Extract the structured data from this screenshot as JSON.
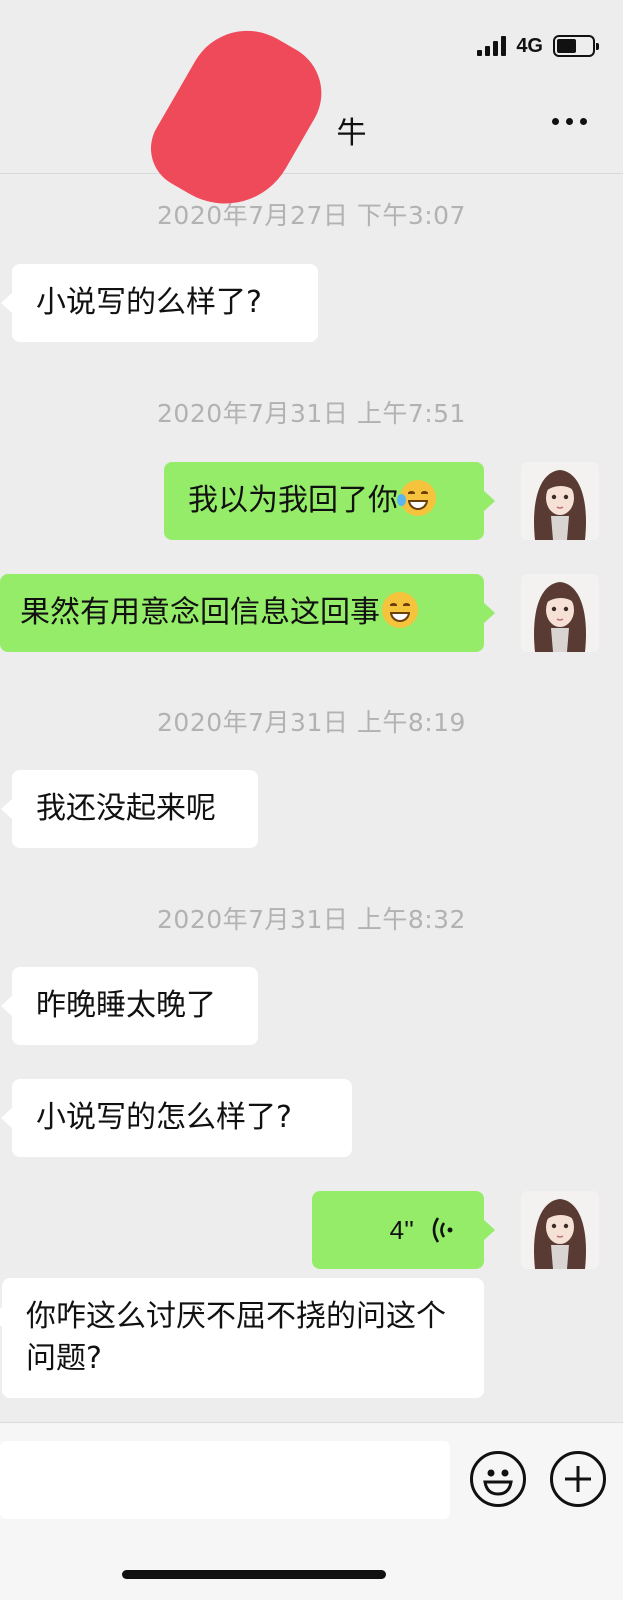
{
  "status_bar": {
    "left_fragment": ")",
    "network": "4G"
  },
  "nav": {
    "title": "牛",
    "more_icon": "more-dots-icon"
  },
  "messages": [
    {
      "type": "timestamp",
      "text": "2020年7月27日 下午3:07"
    },
    {
      "type": "text",
      "side": "in",
      "text": "小说写的么样了?"
    },
    {
      "type": "timestamp",
      "text": "2020年7月31日 上午7:51"
    },
    {
      "type": "text",
      "side": "out",
      "text": "我以为我回了你",
      "emoji": "laughing-tears-emoji"
    },
    {
      "type": "text",
      "side": "out",
      "text": "果然有用意念回信息这回事",
      "emoji": "grinning-emoji"
    },
    {
      "type": "timestamp",
      "text": "2020年7月31日 上午8:19"
    },
    {
      "type": "text",
      "side": "in",
      "text": "我还没起来呢"
    },
    {
      "type": "timestamp",
      "text": "2020年7月31日 上午8:32"
    },
    {
      "type": "text",
      "side": "in",
      "text": "昨晚睡太晚了"
    },
    {
      "type": "text",
      "side": "in",
      "text": "小说写的怎么样了?"
    },
    {
      "type": "voice",
      "side": "out",
      "duration": "4''"
    },
    {
      "type": "text",
      "side": "in",
      "text": "你咋这么讨厌不屈不挠的问这个问题?"
    }
  ],
  "input_bar": {
    "emoji_icon": "smiley-icon",
    "plus_icon": "plus-icon"
  },
  "colors": {
    "outgoing_bubble": "#95ec69",
    "incoming_bubble": "#ffffff",
    "background": "#ededed",
    "redaction": "#ef4a5a"
  }
}
